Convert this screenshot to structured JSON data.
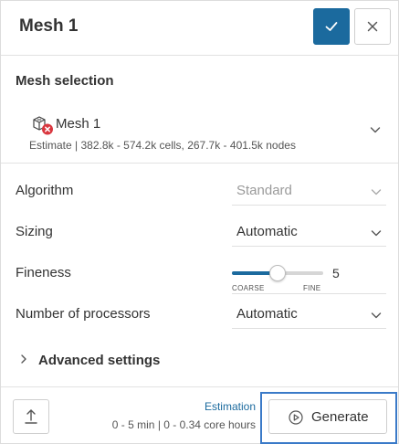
{
  "header": {
    "title": "Mesh 1"
  },
  "mesh_selection": {
    "title": "Mesh selection",
    "mesh_name": "Mesh 1",
    "estimate": "Estimate | 382.8k - 574.2k cells, 267.7k - 401.5k nodes"
  },
  "form": {
    "algorithm": {
      "label": "Algorithm",
      "value": "Standard",
      "disabled": true
    },
    "sizing": {
      "label": "Sizing",
      "value": "Automatic"
    },
    "fineness": {
      "label": "Fineness",
      "value": "5",
      "min_label": "COARSE",
      "max_label": "FINE",
      "fraction": 0.5
    },
    "processors": {
      "label": "Number of processors",
      "value": "Automatic"
    }
  },
  "advanced": {
    "label": "Advanced settings"
  },
  "footer": {
    "estimation_link": "Estimation",
    "estimation_values": "0 - 5 min | 0 - 0.34 core hours",
    "generate_label": "Generate"
  },
  "colors": {
    "accent": "#1b6a9e",
    "error": "#d9363e",
    "highlight": "#3a7ac8"
  },
  "icons": [
    "check-icon",
    "close-icon",
    "mesh-error-icon",
    "chevron-down-icon",
    "chevron-right-icon",
    "upload-icon",
    "play-icon"
  ]
}
